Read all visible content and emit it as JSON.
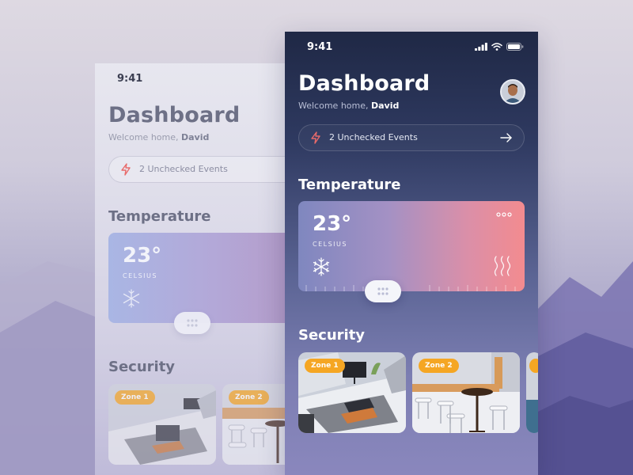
{
  "status": {
    "time": "9:41"
  },
  "header": {
    "title": "Dashboard",
    "welcome_prefix": "Welcome home,",
    "user_name": "David"
  },
  "events": {
    "label": "2 Unchecked Events"
  },
  "temperature": {
    "heading": "Temperature",
    "value": "23°",
    "unit": "CELSIUS"
  },
  "security": {
    "heading": "Security",
    "zones": [
      {
        "label": "Zone 1"
      },
      {
        "label": "Zone 2"
      }
    ]
  },
  "colors": {
    "accent_orange": "#f5a623",
    "bolt_red": "#e86a6a",
    "dark_navy": "#1f2845"
  },
  "icons": [
    "signal-icon",
    "wifi-icon",
    "battery-icon",
    "bolt-icon",
    "arrow-right-icon",
    "more-icon",
    "snowflake-icon",
    "heat-icon"
  ]
}
